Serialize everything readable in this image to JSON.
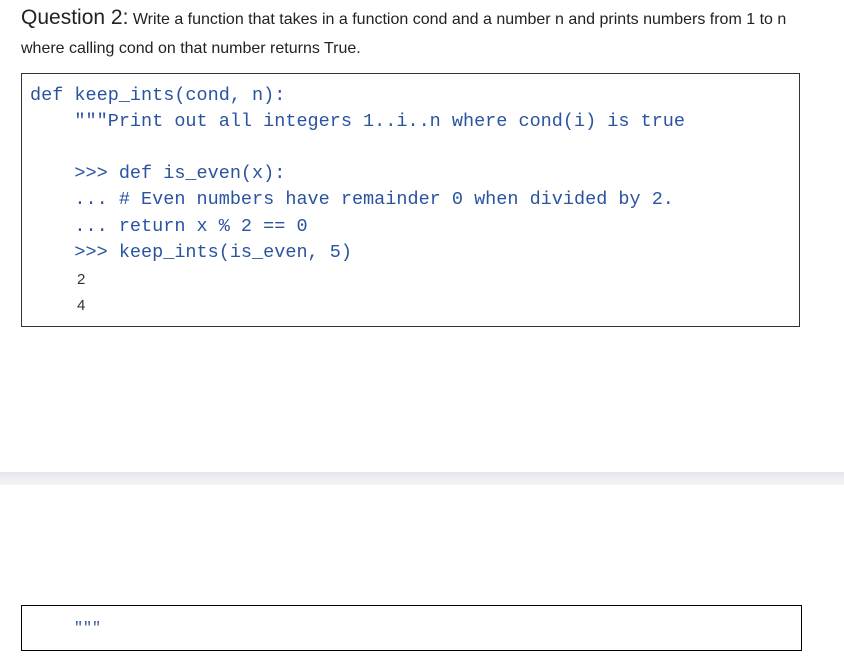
{
  "question": {
    "number": "Question 2:",
    "text": " Write a function that takes in a function cond and a number n and prints numbers from 1 to n where calling cond on that number returns True."
  },
  "code": {
    "lines": [
      "def keep_ints(cond, n):",
      "    \"\"\"Print out all integers 1..i..n where cond(i) is true",
      "    >>> def is_even(x):",
      "    ... # Even numbers have remainder 0 when divided by 2.",
      "    ... return x % 2 == 0",
      "    >>> keep_ints(is_even, 5)"
    ],
    "outputs": [
      "2",
      "4"
    ]
  },
  "answer_box": {
    "text": "\"\"\""
  },
  "colors": {
    "code": "#2a53a0"
  }
}
